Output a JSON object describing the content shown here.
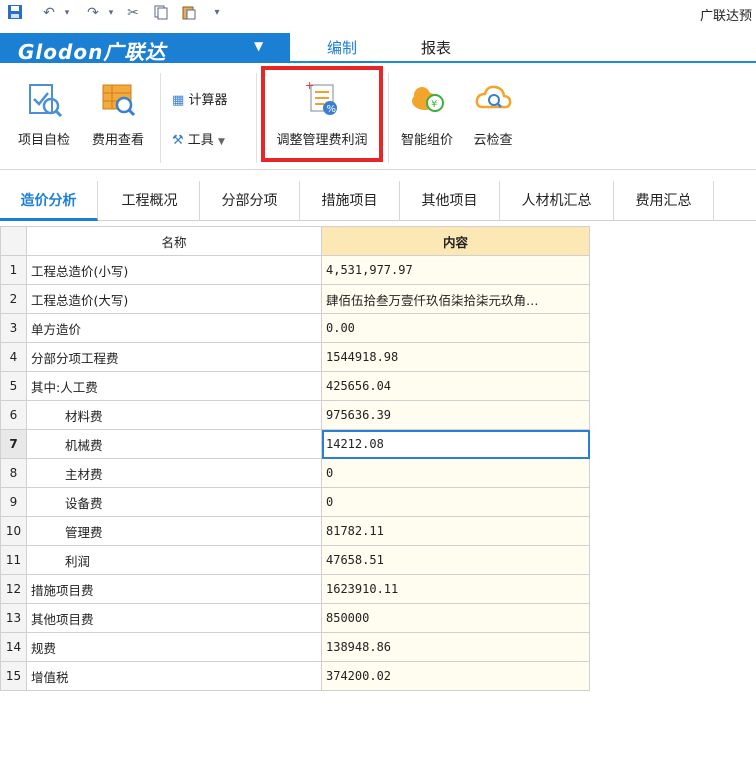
{
  "qat": {
    "icons": [
      "save-icon",
      "undo-icon",
      "redo-icon",
      "cut-icon",
      "copy-icon",
      "paste-icon",
      "customize-icon"
    ],
    "title": "广联达预"
  },
  "brand": {
    "logo": "Glodon广联达",
    "caret": "▼"
  },
  "menu_tabs": [
    {
      "label": "编制",
      "active": true
    },
    {
      "label": "报表",
      "active": false
    }
  ],
  "ribbon": {
    "project_check": "项目自检",
    "fee_view": "费用查看",
    "calculator": "计算器",
    "tools": "工具",
    "adjust_fee_profit": "调整管理费利润",
    "smart_pricing": "智能组价",
    "cloud_check": "云检查"
  },
  "tabs": [
    {
      "label": "造价分析",
      "active": true
    },
    {
      "label": "工程概况",
      "active": false
    },
    {
      "label": "分部分项",
      "active": false
    },
    {
      "label": "措施项目",
      "active": false
    },
    {
      "label": "其他项目",
      "active": false
    },
    {
      "label": "人材机汇总",
      "active": false
    },
    {
      "label": "费用汇总",
      "active": false
    }
  ],
  "table": {
    "headers": {
      "name": "名称",
      "content": "内容"
    },
    "rows": [
      {
        "no": "1",
        "name": "工程总造价(小写)",
        "value": "4,531,977.97"
      },
      {
        "no": "2",
        "name": "工程总造价(大写)",
        "value": "肆佰伍拾叁万壹仟玖佰柒拾柒元玖角…"
      },
      {
        "no": "3",
        "name": "单方造价",
        "value": "0.00"
      },
      {
        "no": "4",
        "name": "分部分项工程费",
        "value": "1544918.98"
      },
      {
        "no": "5",
        "name": "其中:人工费",
        "value": "425656.04"
      },
      {
        "no": "6",
        "name": "材料费",
        "value": "975636.39"
      },
      {
        "no": "7",
        "name": "机械费",
        "value": "14212.08"
      },
      {
        "no": "8",
        "name": "主材费",
        "value": "0"
      },
      {
        "no": "9",
        "name": "设备费",
        "value": "0"
      },
      {
        "no": "10",
        "name": "管理费",
        "value": "81782.11"
      },
      {
        "no": "11",
        "name": "利润",
        "value": "47658.51"
      },
      {
        "no": "12",
        "name": "措施项目费",
        "value": "1623910.11"
      },
      {
        "no": "13",
        "name": "其他项目费",
        "value": "850000"
      },
      {
        "no": "14",
        "name": "规费",
        "value": "138948.86"
      },
      {
        "no": "15",
        "name": "增值税",
        "value": "374200.02"
      }
    ]
  },
  "colors": {
    "brand_blue": "#1b7fd4",
    "highlight_red": "#e8262a",
    "header_content_bg": "#fbe8b4"
  }
}
